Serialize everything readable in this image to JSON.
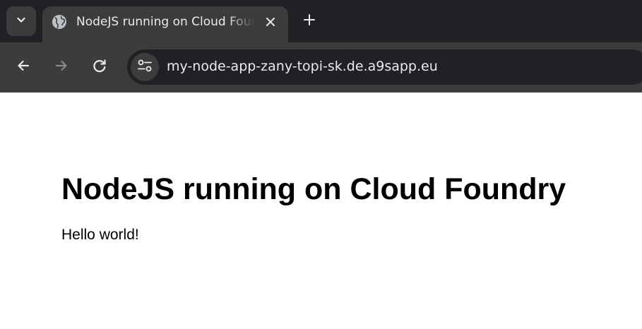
{
  "browser": {
    "tab": {
      "title": "NodeJS running on Cloud Foundry",
      "favicon": "globe-icon"
    },
    "address_bar": {
      "url": "my-node-app-zany-topi-sk.de.a9sapp.eu",
      "site_info_icon": "tune-icon"
    },
    "icons": {
      "tab_search": "chevron-down-icon",
      "close_tab": "close-icon",
      "new_tab": "plus-icon",
      "back": "arrow-left-icon",
      "forward": "arrow-right-icon",
      "reload": "reload-icon"
    },
    "colors": {
      "tabstrip_bg": "#202124",
      "active_tab_bg": "#3c3c3c",
      "omnibox_bg": "#202124",
      "text": "#e8eaed",
      "disabled_icon": "#8a8a8a"
    }
  },
  "page": {
    "heading": "NodeJS running on Cloud Foundry",
    "text": "Hello world!"
  }
}
